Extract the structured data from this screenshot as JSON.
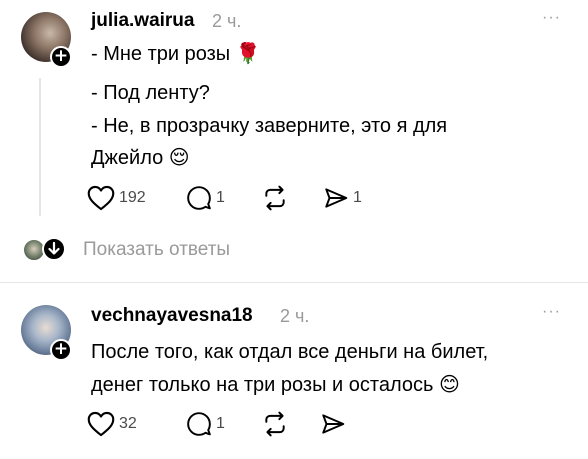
{
  "colors": {
    "text": "#000000",
    "muted": "#9a9a9a",
    "divider": "#e6e6e6"
  },
  "comments": [
    {
      "username": "julia.wairua",
      "time": "2 ч.",
      "lines": [
        "- Мне три розы 🌹",
        "- Под ленту?",
        "- Не, в прозрачку заверните, это я для",
        "Джейло 😌"
      ],
      "likes": "192",
      "replies": "1",
      "shares": "1"
    },
    {
      "username": "vechnayavesna18",
      "time": "2 ч.",
      "lines": [
        "После того, как отдал все деньги на билет,",
        "денег только на три розы и осталось 😊"
      ],
      "likes": "32",
      "replies": "1"
    }
  ],
  "show_replies_label": "Показать ответы",
  "more_label": "···",
  "icons": {
    "like": "heart-icon",
    "reply": "comment-bubble-icon",
    "repost": "repost-icon",
    "share": "send-icon",
    "follow": "plus-icon",
    "expand": "arrow-down-icon"
  }
}
